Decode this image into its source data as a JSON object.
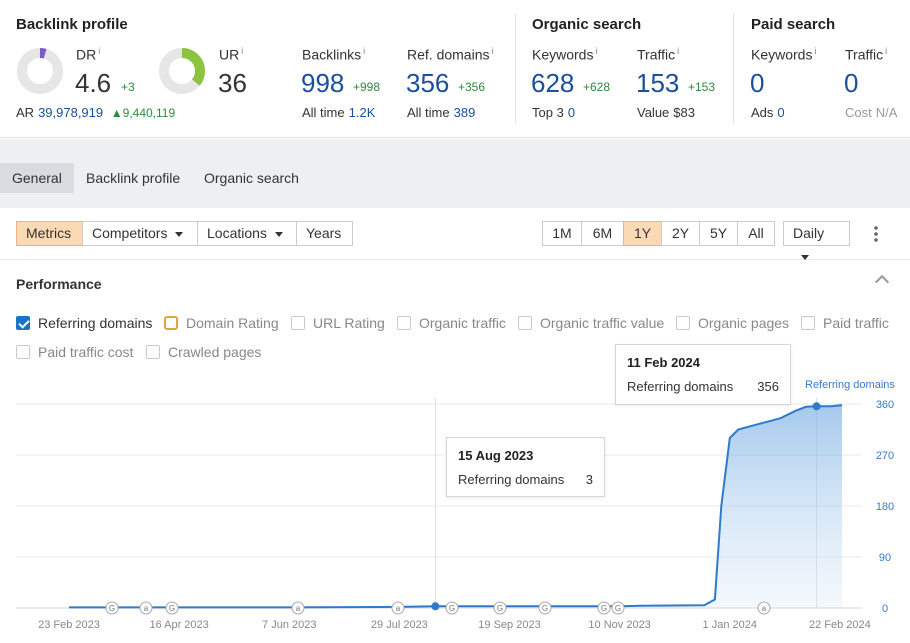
{
  "overview": {
    "backlink_profile": {
      "title": "Backlink profile",
      "dr": {
        "label": "DR",
        "info": "i",
        "value": "4.6",
        "delta": "+3",
        "ring_fraction": 0.046
      },
      "ur": {
        "label": "UR",
        "info": "i",
        "value": "36",
        "ring_fraction": 0.36
      },
      "ar": {
        "label": "AR",
        "value": "39,978,919",
        "delta": "9,440,119"
      },
      "backlinks": {
        "label": "Backlinks",
        "info": "i",
        "value": "998",
        "delta": "+998",
        "sub_label": "All time",
        "sub_value": "1.2K"
      },
      "ref_domains": {
        "label": "Ref. domains",
        "info": "i",
        "value": "356",
        "delta": "+356",
        "sub_label": "All time",
        "sub_value": "389"
      }
    },
    "organic_search": {
      "title": "Organic search",
      "keywords": {
        "label": "Keywords",
        "info": "i",
        "value": "628",
        "delta": "+628",
        "sub_label": "Top 3",
        "sub_value": "0"
      },
      "traffic": {
        "label": "Traffic",
        "info": "i",
        "value": "153",
        "delta": "+153",
        "sub_label": "Value",
        "sub_value": "$83"
      }
    },
    "paid_search": {
      "title": "Paid search",
      "keywords": {
        "label": "Keywords",
        "info": "i",
        "value": "0",
        "sub_label": "Ads",
        "sub_value": "0"
      },
      "traffic": {
        "label": "Traffic",
        "info": "i",
        "value": "0",
        "sub_label": "Cost",
        "sub_value": "N/A"
      }
    }
  },
  "tabs": [
    "General",
    "Backlink profile",
    "Organic search"
  ],
  "filters": {
    "metrics": "Metrics",
    "competitors": "Competitors",
    "locations": "Locations",
    "years": "Years",
    "ranges": [
      "1M",
      "6M",
      "1Y",
      "2Y",
      "5Y",
      "All"
    ],
    "active_range": "1Y",
    "interval": "Daily"
  },
  "performance": {
    "title": "Performance",
    "checkboxes": [
      {
        "label": "Referring domains",
        "checked": true
      },
      {
        "label": "Domain Rating",
        "checked": false
      },
      {
        "label": "URL Rating",
        "checked": false
      },
      {
        "label": "Organic traffic",
        "checked": false
      },
      {
        "label": "Organic traffic value",
        "checked": false
      },
      {
        "label": "Organic pages",
        "checked": false
      },
      {
        "label": "Paid traffic",
        "checked": false
      },
      {
        "label": "Paid traffic cost",
        "checked": false
      },
      {
        "label": "Crawled pages",
        "checked": false
      }
    ],
    "tooltips": [
      {
        "date": "11 Feb 2024",
        "series": "Referring domains",
        "value": "356"
      },
      {
        "date": "15 Aug 2023",
        "series": "Referring domains",
        "value": "3"
      }
    ]
  },
  "colors": {
    "accent": "#1a73c9",
    "positive": "#2e8b3d",
    "active_tab": "#fcd9b5",
    "dr_ring": "#7b5cc4",
    "ur_ring": "#8cc43f"
  },
  "chart_data": {
    "type": "area",
    "series": [
      {
        "name": "Referring domains",
        "points": [
          [
            "2023-02-23",
            1
          ],
          [
            "2023-04-16",
            1
          ],
          [
            "2023-06-07",
            1
          ],
          [
            "2023-07-29",
            2
          ],
          [
            "2023-08-15",
            3
          ],
          [
            "2023-09-19",
            3
          ],
          [
            "2023-11-10",
            3
          ],
          [
            "2023-11-20",
            4
          ],
          [
            "2023-12-20",
            5
          ],
          [
            "2023-12-25",
            15
          ],
          [
            "2023-12-28",
            180
          ],
          [
            "2024-01-01",
            300
          ],
          [
            "2024-01-05",
            315
          ],
          [
            "2024-01-15",
            325
          ],
          [
            "2024-01-25",
            335
          ],
          [
            "2024-02-01",
            348
          ],
          [
            "2024-02-06",
            355
          ],
          [
            "2024-02-11",
            356
          ],
          [
            "2024-02-18",
            356
          ],
          [
            "2024-02-23",
            358
          ]
        ]
      }
    ],
    "x_ticks": [
      "23 Feb 2023",
      "16 Apr 2023",
      "7 Jun 2023",
      "29 Jul 2023",
      "19 Sep 2023",
      "10 Nov 2023",
      "1 Jan 2024",
      "22 Feb 2024"
    ],
    "y_ticks": [
      0,
      90,
      180,
      270,
      360
    ],
    "ylim": [
      0,
      360
    ],
    "series_label": "Referring domains",
    "annotations": [
      "G",
      "a",
      "G",
      "a",
      "a",
      "G",
      "G",
      "G",
      "G",
      "G",
      "a"
    ],
    "grid": true
  }
}
